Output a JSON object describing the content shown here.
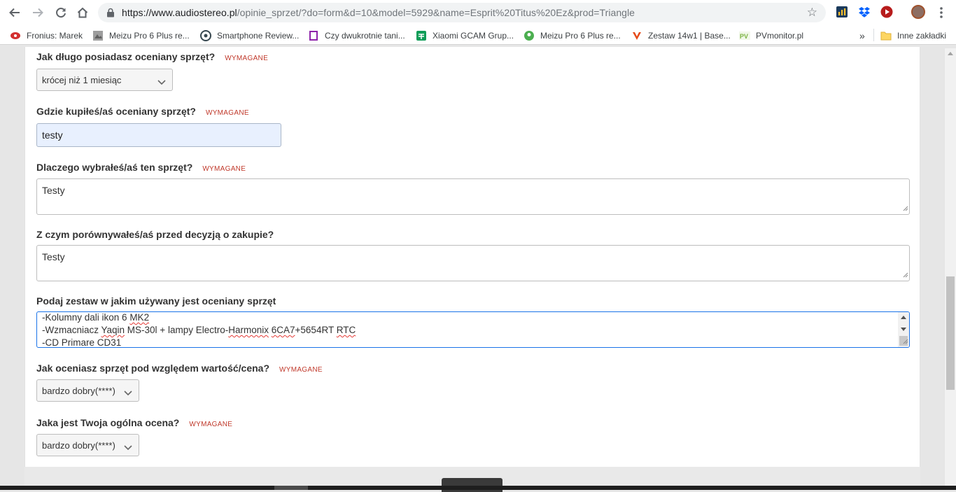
{
  "browser": {
    "url_host": "https://www.audiostereo.pl",
    "url_path": "/opinie_sprzet/?do=form&d=10&model=5929&name=Esprit%20Titus%20Ez&prod=Triangle",
    "bookmarks": [
      {
        "label": "Fronius: Marek",
        "color": "#d32f2f"
      },
      {
        "label": "Meizu Pro 6 Plus re...",
        "color": "#616161"
      },
      {
        "label": "Smartphone Review...",
        "color": "#37474f"
      },
      {
        "label": "Czy dwukrotnie tani...",
        "color": "#8e24aa"
      },
      {
        "label": "Xiaomi GCAM Grup...",
        "color": "#0f9d58"
      },
      {
        "label": "Meizu Pro 6 Plus re...",
        "color": "#4caf50"
      },
      {
        "label": "Zestaw 14w1 | Base...",
        "color": "#e64a19"
      },
      {
        "label": "PVmonitor.pl",
        "color": "#7cb342"
      }
    ],
    "bookmarks_more": "»",
    "other_bookmarks": "Inne zakładki"
  },
  "form": {
    "required_tag": "WYMAGANE",
    "q_duration": {
      "label": "Jak długo posiadasz oceniany sprzęt?",
      "value": "krócej niż 1 miesiąc"
    },
    "q_where": {
      "label": "Gdzie kupiłeś/aś oceniany sprzęt?",
      "value": "testy"
    },
    "q_why": {
      "label": "Dlaczego wybrałeś/aś ten sprzęt?",
      "value": "Testy"
    },
    "q_compare": {
      "label": "Z czym porównywałeś/aś przed decyzją o zakupie?",
      "value": "Testy"
    },
    "q_system": {
      "label": "Podaj zestaw w jakim używany jest oceniany sprzęt",
      "lines": [
        "-Kolumny dali ikon 6 MK2",
        "-Wzmacniacz Yaqin MS-30l + lampy Electro-Harmonix 6CA7+5654RT RTC",
        "-CD Primare CD31"
      ]
    },
    "q_value": {
      "label": "Jak oceniasz sprzęt pod względem wartość/cena?",
      "value": "bardzo dobry(****)"
    },
    "q_overall": {
      "label": "Jaka jest Twoja ogólna ocena?",
      "value": "bardzo dobry(****)"
    }
  }
}
